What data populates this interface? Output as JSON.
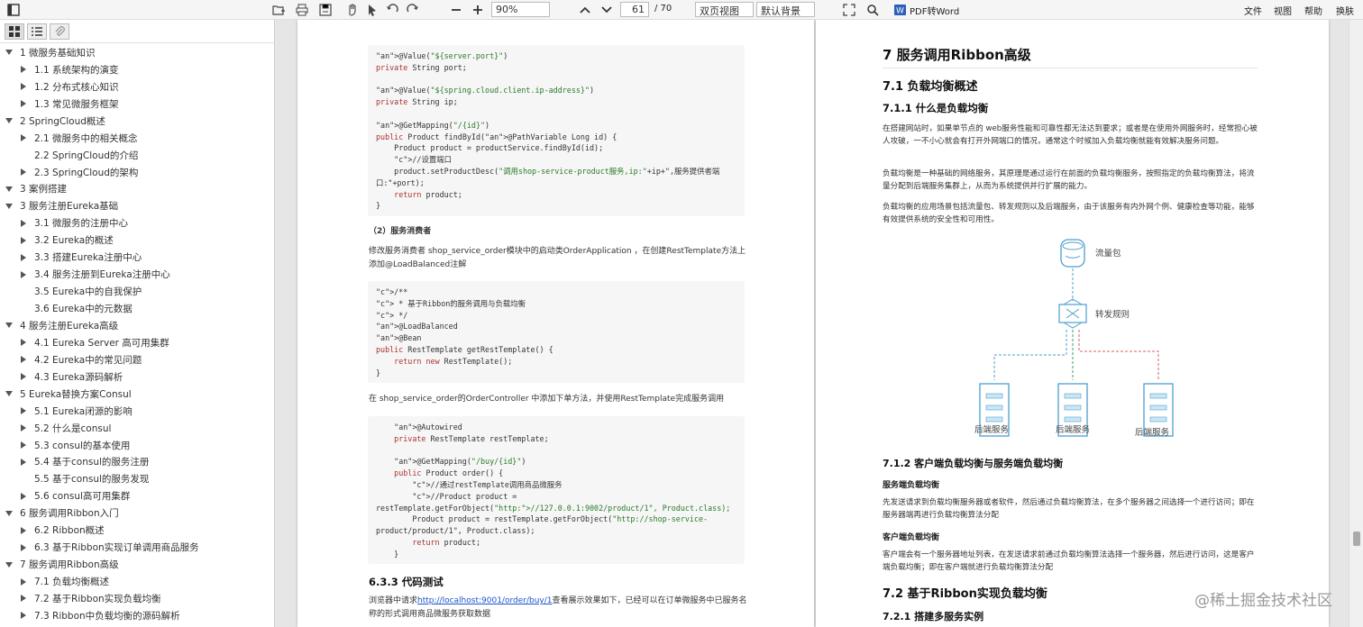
{
  "toolbar": {
    "zoom": "90%",
    "page_current": "61",
    "page_total": "/ 70",
    "view_mode": "双页视图",
    "background": "默认背景",
    "pdf_to_word": "PDF转Word",
    "menu": [
      "文件",
      "视图",
      "帮助",
      "换肤"
    ]
  },
  "sidebar": {
    "items": [
      {
        "label": "1 微服务基础知识",
        "level": 0,
        "expanded": true
      },
      {
        "label": "1.1 系统架构的演变",
        "level": 1,
        "arrow": true
      },
      {
        "label": "1.2 分布式核心知识",
        "level": 1,
        "arrow": true
      },
      {
        "label": "1.3 常见微服务框架",
        "level": 1,
        "arrow": true
      },
      {
        "label": "2 SpringCloud概述",
        "level": 0,
        "expanded": true
      },
      {
        "label": "2.1 微服务中的相关概念",
        "level": 1,
        "arrow": true
      },
      {
        "label": "2.2 SpringCloud的介绍",
        "level": 1,
        "arrow": false
      },
      {
        "label": "2.3 SpringCloud的架构",
        "level": 1,
        "arrow": true
      },
      {
        "label": "3 案例搭建",
        "level": 0,
        "expanded": true
      },
      {
        "label": "3 服务注册Eureka基础",
        "level": 0,
        "expanded": true
      },
      {
        "label": "3.1 微服务的注册中心",
        "level": 1,
        "arrow": true
      },
      {
        "label": "3.2 Eureka的概述",
        "level": 1,
        "arrow": true
      },
      {
        "label": "3.3 搭建Eureka注册中心",
        "level": 1,
        "arrow": true
      },
      {
        "label": "3.4 服务注册到Eureka注册中心",
        "level": 1,
        "arrow": true
      },
      {
        "label": "3.5 Eureka中的自我保护",
        "level": 1,
        "arrow": false
      },
      {
        "label": "3.6 Eureka中的元数据",
        "level": 1,
        "arrow": false
      },
      {
        "label": "4 服务注册Eureka高级",
        "level": 0,
        "expanded": true
      },
      {
        "label": "4.1 Eureka Server 高可用集群",
        "level": 1,
        "arrow": true
      },
      {
        "label": "4.2 Eureka中的常见问题",
        "level": 1,
        "arrow": true
      },
      {
        "label": "4.3 Eureka源码解析",
        "level": 1,
        "arrow": true
      },
      {
        "label": "5 Eureka替换方案Consul",
        "level": 0,
        "expanded": true
      },
      {
        "label": "5.1 Eureka闭源的影响",
        "level": 1,
        "arrow": true
      },
      {
        "label": "5.2 什么是consul",
        "level": 1,
        "arrow": true
      },
      {
        "label": "5.3 consul的基本使用",
        "level": 1,
        "arrow": true
      },
      {
        "label": "5.4 基于consul的服务注册",
        "level": 1,
        "arrow": true
      },
      {
        "label": "5.5 基于consul的服务发现",
        "level": 1,
        "arrow": false
      },
      {
        "label": "5.6 consul高可用集群",
        "level": 1,
        "arrow": true
      },
      {
        "label": "6 服务调用Ribbon入门",
        "level": 0,
        "expanded": true
      },
      {
        "label": "6.2 Ribbon概述",
        "level": 1,
        "arrow": true
      },
      {
        "label": "6.3 基于Ribbon实现订单调用商品服务",
        "level": 1,
        "arrow": true
      },
      {
        "label": "7 服务调用Ribbon高级",
        "level": 0,
        "expanded": true
      },
      {
        "label": "7.1 负载均衡概述",
        "level": 1,
        "arrow": true
      },
      {
        "label": "7.2 基于Ribbon实现负载均衡",
        "level": 1,
        "arrow": true
      },
      {
        "label": "7.3 Ribbon中负载均衡的源码解析",
        "level": 1,
        "arrow": true
      }
    ]
  },
  "left_page": {
    "code1": [
      "@Value(\"${server.port}\")",
      "private String port;",
      "",
      "@Value(\"${spring.cloud.client.ip-address}\")",
      "private String ip;",
      "",
      "@GetMapping(\"/{id}\")",
      "public Product findById(@PathVariable Long id) {",
      "    Product product = productService.findById(id);",
      "    //设置端口",
      "    product.setProductDesc(\"调用shop-service-product服务,ip:\"+ip+\",服务提供者端",
      "口:\"+port);",
      "    return product;",
      "}"
    ],
    "consumer_heading": "（2）服务消费者",
    "para1": "修改服务消费者 shop_service_order模块中的启动类OrderApplication ，在创建RestTemplate方法上添加@LoadBalanced注解",
    "code2": [
      "/**",
      " * 基于Ribbon的服务调用与负载均衡",
      " */",
      "@LoadBalanced",
      "@Bean",
      "public RestTemplate getRestTemplate() {",
      "    return new RestTemplate();",
      "}"
    ],
    "para2": "在 shop_service_order的OrderController 中添加下单方法，并使用RestTemplate完成服务调用",
    "code3": [
      "    @Autowired",
      "    private RestTemplate restTemplate;",
      "",
      "    @GetMapping(\"/buy/{id}\")",
      "    public Product order() {",
      "        //通过restTemplate调用商品微服务",
      "        //Product product =",
      "restTemplate.getForObject(\"http://127.0.0.1:9002/product/1\", Product.class);",
      "        Product product = restTemplate.getForObject(\"http://shop-service-",
      "product/product/1\", Product.class);",
      "        return product;",
      "    }"
    ],
    "h_633": "6.3.3 代码测试",
    "para3_a": "浏览器中请求",
    "para3_link": "http://localhost:9001/order/buy/1",
    "para3_b": "查看展示效果如下，已经可以在订单微服务中已服务名称的形式调用商品微服务获取数据"
  },
  "right_page": {
    "h1": "7 服务调用Ribbon高级",
    "h2_71": "7.1 负载均衡概述",
    "h3_711": "7.1.1 什么是负载均衡",
    "p1": "在搭建网站时，如果单节点的 web服务性能和可靠性都无法达到要求；或者是在使用外网服务时，经常担心被人攻破，一不小心就会有打开外网端口的情况，通常这个时候加入负载均衡就能有效解决服务问题。",
    "p2": "负载均衡是一种基础的网络服务，其原理是通过运行在前面的负载均衡服务，按照指定的负载均衡算法，将流量分配到后端服务集群上，从而为系统提供并行扩展的能力。",
    "p3": "负载均衡的应用场景包括流量包、转发规则以及后端服务，由于该服务有内外网个例、健康检查等功能，能够有效提供系统的安全性和可用性。",
    "diagram": {
      "traffic": "流量包",
      "rules": "转发规则",
      "backends": [
        "后端服务",
        "后端服务",
        "后端服务"
      ]
    },
    "h3_712": "7.1.2 客户端负载均衡与服务端负载均衡",
    "server_lb": "服务端负载均衡",
    "p4": "先发送请求到负载均衡服务器或者软件，然后通过负载均衡算法，在多个服务器之间选择一个进行访问；即在服务器端再进行负载均衡算法分配",
    "client_lb": "客户端负载均衡",
    "p5": "客户端会有一个服务器地址列表，在发送请求前通过负载均衡算法选择一个服务器，然后进行访问，这是客户端负载均衡；即在客户端就进行负载均衡算法分配",
    "h2_72": "7.2 基于Ribbon实现负载均衡",
    "h3_721": "7.2.1 搭建多服务实例"
  },
  "watermark": "@稀土掘金技术社区",
  "colors": {
    "diagram_blue": "#4a9fd0",
    "diagram_red": "#d96060",
    "diagram_green": "#3aa060",
    "link": "#1a55cc"
  }
}
